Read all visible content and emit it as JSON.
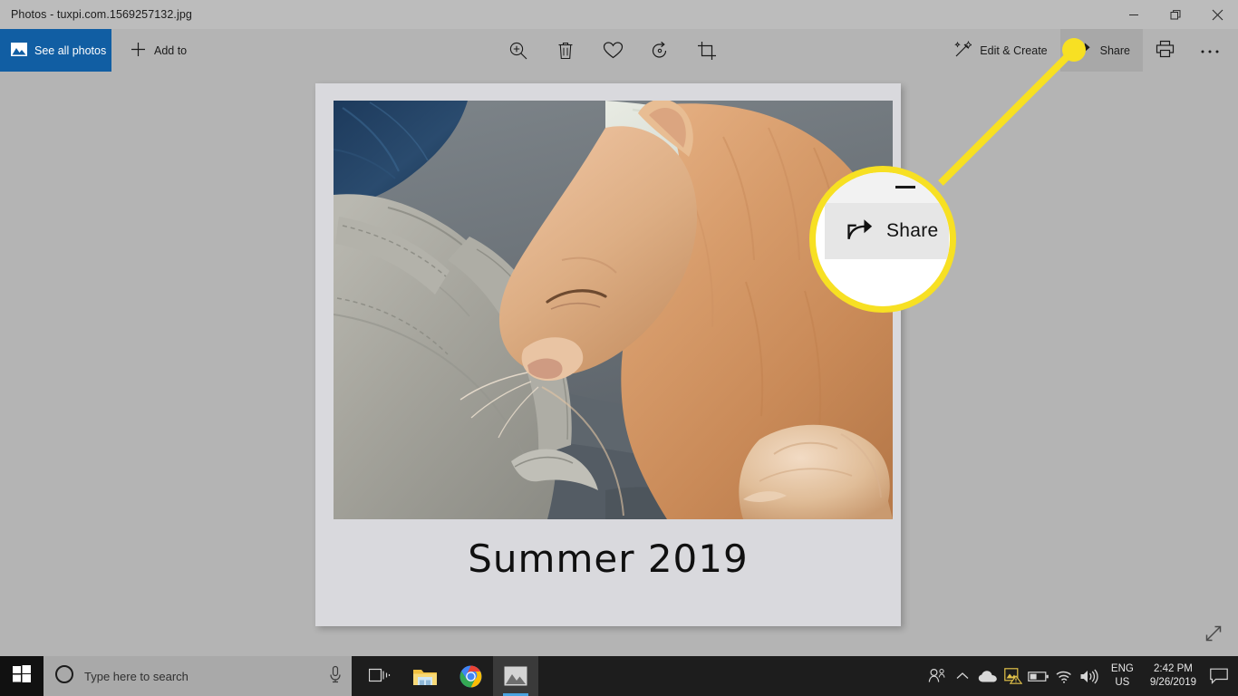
{
  "window": {
    "title": "Photos - tuxpi.com.1569257132.jpg",
    "controls": {
      "minimize": "minimize-button",
      "restore": "restore-button",
      "close": "close-button"
    }
  },
  "toolbar": {
    "see_all_photos": "See all photos",
    "add_to": "Add to",
    "center_tools": [
      {
        "name": "zoom-in-icon",
        "label": "Zoom"
      },
      {
        "name": "delete-icon",
        "label": "Delete"
      },
      {
        "name": "heart-icon",
        "label": "Add to favorites"
      },
      {
        "name": "rotate-icon",
        "label": "Rotate"
      },
      {
        "name": "crop-icon",
        "label": "Crop & rotate"
      }
    ],
    "edit_create": "Edit & Create",
    "share": "Share",
    "print": "Print",
    "more": "See more"
  },
  "content": {
    "caption": "Summer 2019",
    "photo_alt": "Sleeping orange tabby cat on grey clothing"
  },
  "callout": {
    "share_label": "Share",
    "highlight_color": "#f7e023"
  },
  "taskbar": {
    "search_placeholder": "Type here to search",
    "apps": [
      {
        "name": "task-view-icon",
        "label": "Task View",
        "active": false
      },
      {
        "name": "file-explorer-icon",
        "label": "File Explorer",
        "active": false
      },
      {
        "name": "chrome-icon",
        "label": "Google Chrome",
        "active": false
      },
      {
        "name": "photos-icon",
        "label": "Photos",
        "active": true
      }
    ],
    "tray": {
      "language_line1": "ENG",
      "language_line2": "US",
      "time": "2:42 PM",
      "date": "9/26/2019"
    }
  }
}
